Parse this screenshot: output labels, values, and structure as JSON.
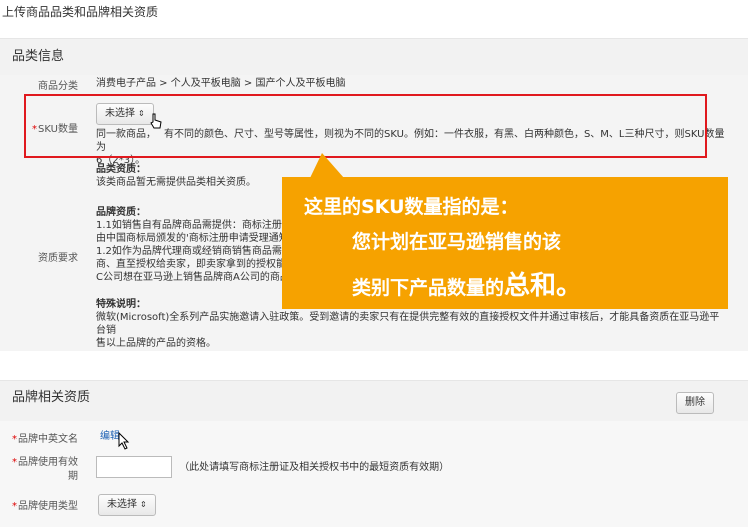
{
  "page": {
    "title": "上传商品品类和品牌相关资质"
  },
  "category_section": {
    "header": "品类信息",
    "category": {
      "label": "商品分类",
      "value": "消费电子产品 > 个人及平板电脑 > 国产个人及平板电脑"
    },
    "sku": {
      "label": "SKU数量",
      "select_value": "未选择",
      "desc_line1": "同一款商品，",
      "desc_line1b": "有不同的颜色、尺寸、型号等属性，则视为不同的SKU。例如：一件衣服，有黑、白两种颜色，S、M、L三种尺寸，则SKU数量为",
      "desc_line2": "6（2*3）。"
    },
    "qualification": {
      "label": "资质要求",
      "category_title": "品类资质：",
      "category_text": "该类商品暂无需提供品类相关资质。",
      "brand_title": "品牌资质：",
      "brand_lines": [
        "1.1如销售自有品牌商品需提供：商标注册证",
        "由中国商标局颁发的'商标注册申请受理通知",
        "1.2如作为品牌代理商或经销商销售商品需提",
        "商、直至授权给卖家，即卖家拿到的授权能",
        "C公司想在亚马逊上销售品牌商A公司的商品"
      ],
      "special_title": "特殊说明：",
      "special_line1": "微软(Microsoft)全系列产品实施邀请入驻政策。受到邀请的卖家只有在提供完整有效的直接授权文件并通过审核后，才能具备资质在亚马逊平台销",
      "special_line2": "售以上品牌的产品的资格。"
    }
  },
  "callout": {
    "line1": "这里的SKU数量指的是：",
    "line2": "您计划在亚马逊销售的该",
    "line3a": "类别下产品数量的",
    "line3b": "总和。"
  },
  "brand_section": {
    "header": "品牌相关资质",
    "delete_label": "删除",
    "name": {
      "label": "品牌中英文名",
      "link": "编辑"
    },
    "validity": {
      "label_line1": "品牌使用有效",
      "label_line2": "期",
      "hint": "（此处请填写商标注册证及相关授权书中的最短资质有效期）"
    },
    "usage_type": {
      "label": "品牌使用类型",
      "select_value": "未选择"
    }
  },
  "colors": {
    "highlight": "#e0191e",
    "callout": "#f6a200",
    "link": "#1a5fb4"
  }
}
